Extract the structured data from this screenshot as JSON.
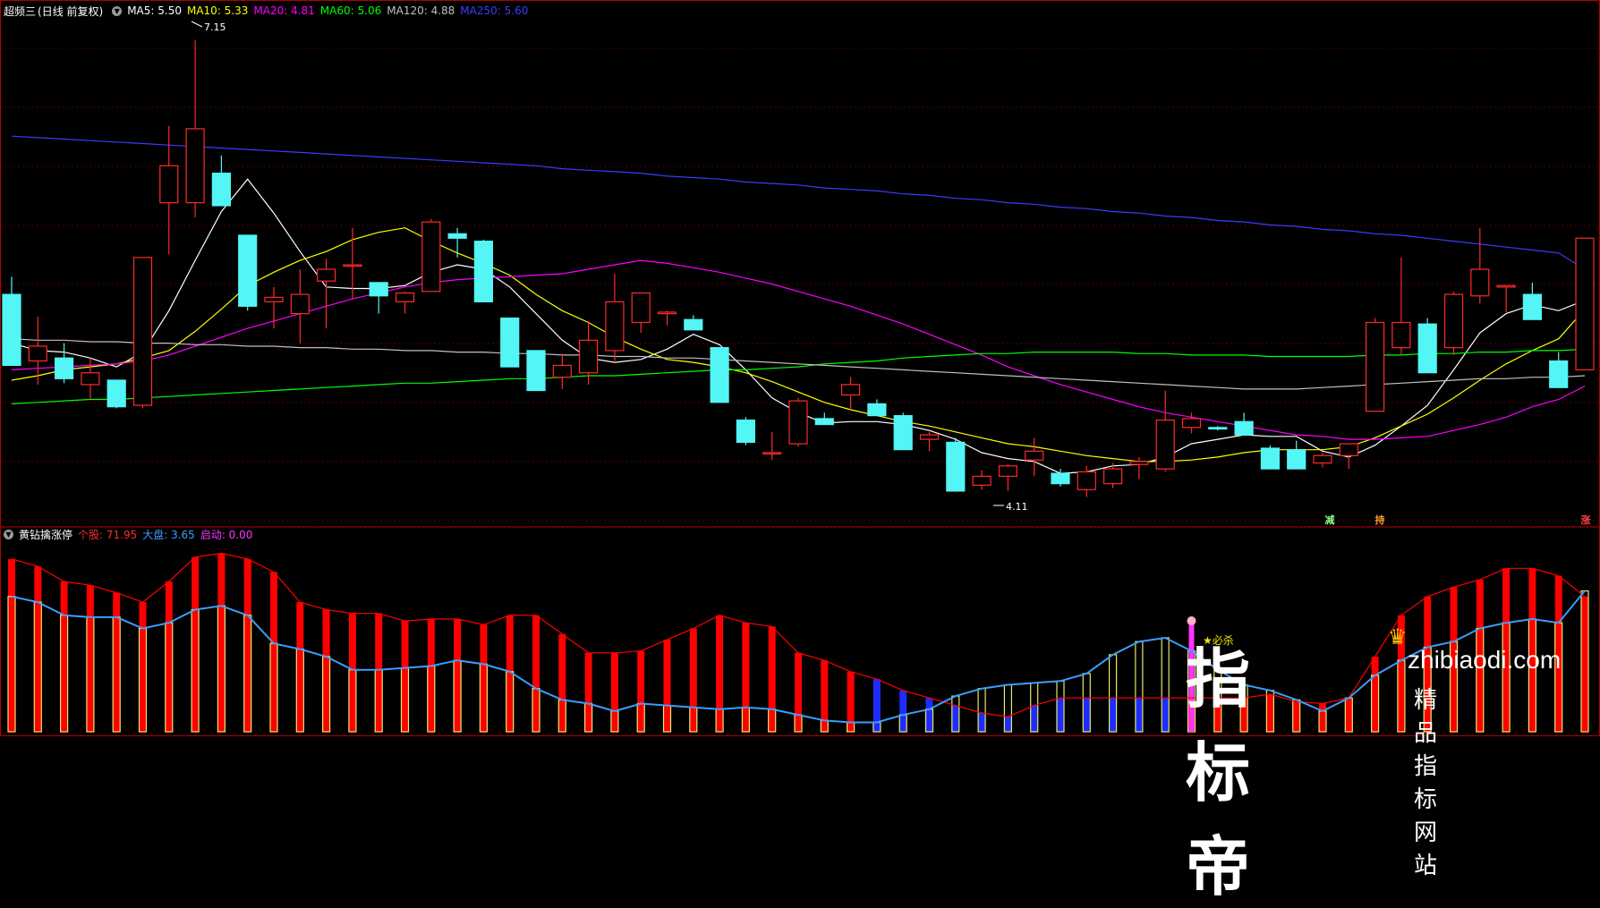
{
  "main_panel": {
    "title": "超频三",
    "period": "(日线 前复权)",
    "mas": [
      {
        "label": "MA5: 5.50",
        "color": "#ffffff"
      },
      {
        "label": "MA10: 5.33",
        "color": "#ffff00"
      },
      {
        "label": "MA20: 4.81",
        "color": "#ff00ff"
      },
      {
        "label": "MA60: 5.06",
        "color": "#00ff00"
      },
      {
        "label": "MA120: 4.88",
        "color": "#c0c0c0"
      },
      {
        "label": "MA250: 5.60",
        "color": "#3b3bff"
      }
    ],
    "high_label": "7.15",
    "low_label": "4.11"
  },
  "sub_panel": {
    "title": "黄钻擒涨停",
    "stock": "个股: 71.95",
    "market": "大盘: 3.65",
    "start": "启动: 0.00",
    "bisha": "★必杀"
  },
  "signals": [
    {
      "text": "减",
      "color": "#8cff8c"
    },
    {
      "text": "持",
      "color": "#ff9933"
    },
    {
      "text": "涨",
      "color": "#ff4444"
    }
  ],
  "watermark": {
    "cn": "指标帝",
    "url": "zhibiaodi.com",
    "sub": "精品指标网站"
  },
  "colors": {
    "up": "#ff2a2a",
    "down": "#53f5f5",
    "grid": "#5a0000",
    "border": "#b00000",
    "stock": "#ff0000",
    "market": "#3b9dff",
    "blue_bar": "#1e2cff",
    "yellow": "#e8e86a"
  },
  "chart_data": [
    {
      "type": "candlestick",
      "title": "超频三 (日线 前复权)",
      "ylim": [
        3.9,
        7.3
      ],
      "ohlc": [
        [
          5.43,
          5.55,
          4.95,
          4.95
        ],
        [
          4.98,
          5.28,
          4.82,
          5.08
        ],
        [
          5.0,
          5.1,
          4.83,
          4.86
        ],
        [
          4.82,
          5.0,
          4.72,
          4.9
        ],
        [
          4.85,
          4.85,
          4.66,
          4.67
        ],
        [
          4.68,
          5.68,
          4.66,
          5.68
        ],
        [
          6.05,
          6.57,
          5.7,
          6.3
        ],
        [
          6.05,
          7.15,
          5.95,
          6.55
        ],
        [
          6.25,
          6.37,
          6.03,
          6.03
        ],
        [
          5.83,
          5.83,
          5.32,
          5.35
        ],
        [
          5.38,
          5.48,
          5.2,
          5.41
        ],
        [
          5.3,
          5.6,
          5.1,
          5.43
        ],
        [
          5.52,
          5.67,
          5.2,
          5.6
        ],
        [
          5.63,
          5.88,
          5.4,
          5.63
        ],
        [
          5.51,
          5.51,
          5.3,
          5.42
        ],
        [
          5.38,
          5.45,
          5.3,
          5.44
        ],
        [
          5.45,
          5.94,
          5.45,
          5.92
        ],
        [
          5.84,
          5.88,
          5.68,
          5.81
        ],
        [
          5.79,
          5.8,
          5.38,
          5.38
        ],
        [
          5.27,
          5.27,
          4.94,
          4.94
        ],
        [
          5.05,
          5.05,
          4.78,
          4.78
        ],
        [
          4.87,
          5.03,
          4.79,
          4.95
        ],
        [
          4.9,
          5.25,
          4.82,
          5.12
        ],
        [
          5.05,
          5.57,
          4.98,
          5.38
        ],
        [
          5.24,
          5.44,
          5.17,
          5.44
        ],
        [
          5.3,
          5.32,
          5.22,
          5.31
        ],
        [
          5.26,
          5.29,
          5.19,
          5.19
        ],
        [
          5.07,
          5.07,
          4.7,
          4.7
        ],
        [
          4.58,
          4.6,
          4.41,
          4.43
        ],
        [
          4.36,
          4.5,
          4.31,
          4.36
        ],
        [
          4.42,
          4.73,
          4.4,
          4.71
        ],
        [
          4.59,
          4.63,
          4.55,
          4.55
        ],
        [
          4.75,
          4.87,
          4.65,
          4.82
        ],
        [
          4.69,
          4.72,
          4.61,
          4.61
        ],
        [
          4.61,
          4.63,
          4.38,
          4.38
        ],
        [
          4.45,
          4.5,
          4.37,
          4.48
        ],
        [
          4.43,
          4.46,
          4.1,
          4.1
        ],
        [
          4.14,
          4.24,
          4.11,
          4.2
        ],
        [
          4.2,
          4.28,
          4.1,
          4.27
        ],
        [
          4.31,
          4.46,
          4.2,
          4.37
        ],
        [
          4.22,
          4.25,
          4.13,
          4.15
        ],
        [
          4.11,
          4.27,
          4.06,
          4.23
        ],
        [
          4.15,
          4.29,
          4.12,
          4.25
        ],
        [
          4.28,
          4.33,
          4.18,
          4.3
        ],
        [
          4.25,
          4.78,
          4.23,
          4.58
        ],
        [
          4.53,
          4.63,
          4.49,
          4.59
        ],
        [
          4.53,
          4.54,
          4.51,
          4.52
        ],
        [
          4.57,
          4.63,
          4.48,
          4.48
        ],
        [
          4.39,
          4.41,
          4.25,
          4.25
        ],
        [
          4.38,
          4.44,
          4.25,
          4.25
        ],
        [
          4.29,
          4.36,
          4.26,
          4.34
        ],
        [
          4.34,
          4.42,
          4.25,
          4.42
        ],
        [
          4.64,
          5.27,
          4.65,
          5.24
        ],
        [
          5.07,
          5.68,
          5.02,
          5.24
        ],
        [
          5.23,
          5.27,
          4.9,
          4.9
        ],
        [
          5.07,
          5.45,
          5.02,
          5.43
        ],
        [
          5.42,
          5.88,
          5.37,
          5.6
        ],
        [
          5.48,
          5.49,
          5.31,
          5.49
        ],
        [
          5.43,
          5.51,
          5.29,
          5.26
        ],
        [
          4.98,
          5.04,
          4.8,
          4.8
        ],
        [
          4.92,
          5.81,
          4.92,
          5.81
        ]
      ],
      "moving_averages": [
        {
          "name": "MA5",
          "color": "#ffffff",
          "values": [
            5.1,
            5.05,
            5.04,
            5.0,
            4.94,
            5.04,
            5.32,
            5.66,
            5.99,
            6.21,
            5.98,
            5.72,
            5.48,
            5.47,
            5.47,
            5.49,
            5.58,
            5.63,
            5.6,
            5.48,
            5.3,
            5.12,
            5.0,
            4.97,
            4.99,
            5.06,
            5.16,
            5.09,
            4.92,
            4.73,
            4.63,
            4.56,
            4.57,
            4.57,
            4.55,
            4.51,
            4.45,
            4.36,
            4.32,
            4.3,
            4.22,
            4.23,
            4.27,
            4.28,
            4.33,
            4.42,
            4.45,
            4.48,
            4.47,
            4.47,
            4.37,
            4.33,
            4.41,
            4.54,
            4.68,
            4.92,
            5.17,
            5.3,
            5.36,
            5.32,
            5.39
          ]
        },
        {
          "name": "MA10",
          "color": "#ffff00",
          "values": [
            4.85,
            4.88,
            4.92,
            4.94,
            4.96,
            5.0,
            5.05,
            5.18,
            5.33,
            5.49,
            5.58,
            5.66,
            5.72,
            5.8,
            5.85,
            5.88,
            5.79,
            5.71,
            5.64,
            5.56,
            5.43,
            5.32,
            5.24,
            5.14,
            5.06,
            4.99,
            4.97,
            4.94,
            4.9,
            4.84,
            4.77,
            4.7,
            4.65,
            4.61,
            4.57,
            4.54,
            4.5,
            4.46,
            4.42,
            4.4,
            4.37,
            4.34,
            4.32,
            4.3,
            4.3,
            4.31,
            4.33,
            4.36,
            4.38,
            4.38,
            4.38,
            4.4,
            4.46,
            4.54,
            4.62,
            4.73,
            4.85,
            4.96,
            5.05,
            5.13,
            5.33
          ]
        },
        {
          "name": "MA20",
          "color": "#ff00ff",
          "values": [
            4.92,
            4.93,
            4.94,
            4.95,
            4.96,
            4.98,
            5.02,
            5.08,
            5.14,
            5.2,
            5.25,
            5.3,
            5.35,
            5.4,
            5.44,
            5.48,
            5.51,
            5.53,
            5.54,
            5.55,
            5.56,
            5.57,
            5.6,
            5.63,
            5.66,
            5.64,
            5.61,
            5.58,
            5.54,
            5.5,
            5.45,
            5.4,
            5.35,
            5.29,
            5.23,
            5.16,
            5.09,
            5.02,
            4.94,
            4.88,
            4.82,
            4.77,
            4.72,
            4.67,
            4.63,
            4.6,
            4.57,
            4.54,
            4.51,
            4.48,
            4.47,
            4.45,
            4.45,
            4.46,
            4.47,
            4.51,
            4.55,
            4.6,
            4.67,
            4.72,
            4.81
          ]
        },
        {
          "name": "MA60",
          "color": "#00ff00",
          "values": [
            4.69,
            4.7,
            4.71,
            4.72,
            4.72,
            4.73,
            4.74,
            4.75,
            4.76,
            4.77,
            4.78,
            4.79,
            4.8,
            4.81,
            4.82,
            4.83,
            4.83,
            4.84,
            4.85,
            4.86,
            4.86,
            4.87,
            4.88,
            4.88,
            4.89,
            4.9,
            4.91,
            4.92,
            4.92,
            4.93,
            4.94,
            4.96,
            4.97,
            4.98,
            5.0,
            5.01,
            5.02,
            5.03,
            5.03,
            5.04,
            5.04,
            5.04,
            5.04,
            5.03,
            5.03,
            5.02,
            5.02,
            5.02,
            5.01,
            5.01,
            5.01,
            5.01,
            5.02,
            5.02,
            5.03,
            5.03,
            5.04,
            5.04,
            5.05,
            5.05,
            5.06
          ]
        },
        {
          "name": "MA120",
          "color": "#c0c0c0",
          "values": [
            5.13,
            5.12,
            5.12,
            5.11,
            5.11,
            5.1,
            5.1,
            5.09,
            5.09,
            5.08,
            5.08,
            5.07,
            5.07,
            5.06,
            5.06,
            5.05,
            5.05,
            5.04,
            5.04,
            5.03,
            5.03,
            5.02,
            5.02,
            5.01,
            5.01,
            5.0,
            5.0,
            4.99,
            4.98,
            4.97,
            4.96,
            4.95,
            4.94,
            4.93,
            4.92,
            4.91,
            4.9,
            4.89,
            4.88,
            4.87,
            4.86,
            4.85,
            4.84,
            4.83,
            4.82,
            4.81,
            4.8,
            4.79,
            4.79,
            4.79,
            4.8,
            4.81,
            4.82,
            4.83,
            4.84,
            4.85,
            4.86,
            4.86,
            4.87,
            4.87,
            4.88
          ]
        },
        {
          "name": "MA250",
          "color": "#3b3bff",
          "values": [
            6.5,
            6.49,
            6.48,
            6.47,
            6.46,
            6.45,
            6.44,
            6.43,
            6.42,
            6.41,
            6.4,
            6.39,
            6.38,
            6.37,
            6.36,
            6.35,
            6.34,
            6.33,
            6.32,
            6.31,
            6.3,
            6.28,
            6.27,
            6.26,
            6.25,
            6.23,
            6.22,
            6.21,
            6.19,
            6.18,
            6.17,
            6.15,
            6.14,
            6.13,
            6.11,
            6.1,
            6.08,
            6.07,
            6.05,
            6.04,
            6.02,
            6.01,
            5.99,
            5.98,
            5.96,
            5.95,
            5.93,
            5.92,
            5.9,
            5.89,
            5.87,
            5.86,
            5.84,
            5.83,
            5.81,
            5.79,
            5.77,
            5.75,
            5.73,
            5.71,
            5.6
          ]
        }
      ]
    },
    {
      "type": "bar",
      "title": "黄钻擒涨停",
      "ylim": [
        0,
        100
      ],
      "series": [
        {
          "name": "个股",
          "color": "#ff0000",
          "values": [
            92,
            88,
            80,
            78,
            74,
            69,
            80,
            93,
            95,
            92,
            85,
            69,
            65,
            63,
            63,
            59,
            60,
            60,
            57,
            62,
            62,
            52,
            42,
            42,
            43,
            49,
            55,
            62,
            58,
            56,
            42,
            38,
            32,
            28,
            22,
            18,
            14,
            10,
            8,
            14,
            18,
            18,
            18,
            18,
            18,
            18,
            18,
            18,
            20,
            16,
            15,
            18,
            40,
            62,
            72,
            77,
            81,
            87,
            87,
            83,
            72
          ]
        },
        {
          "name": "大盘",
          "color": "#3b9dff",
          "values": [
            72,
            69,
            62,
            61,
            61,
            55,
            58,
            65,
            67,
            62,
            47,
            44,
            40,
            33,
            33,
            34,
            35,
            38,
            36,
            32,
            23,
            17,
            15,
            11,
            15,
            14,
            13,
            12,
            13,
            12,
            9,
            6,
            5,
            5,
            9,
            12,
            19,
            23,
            25,
            26,
            27,
            31,
            41,
            48,
            50,
            43,
            33,
            25,
            22,
            17,
            11,
            18,
            30,
            38,
            45,
            48,
            55,
            58,
            60,
            58,
            75
          ]
        },
        {
          "name": "启动",
          "color": "#ff00ff",
          "values": [
            0
          ]
        }
      ]
    }
  ]
}
